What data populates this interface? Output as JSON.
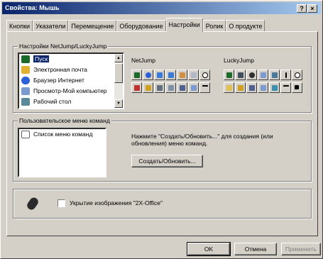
{
  "window": {
    "title": "Свойства: Мышь",
    "help": "?",
    "close": "×"
  },
  "tabs": [
    "Кнопки",
    "Указатели",
    "Перемещение",
    "Оборудование",
    "Настройки",
    "Ролик",
    "О продукте"
  ],
  "active_tab": "Настройки",
  "netjump_group": {
    "legend": "Настройки NetJump/LuckyJump",
    "items": [
      "Пуск",
      "Электронная почта",
      "Браузер Интернет",
      "Просмотр-Мой компьютер",
      "Рабочий стол"
    ],
    "selected": "Пуск",
    "netjump_label": "NetJump",
    "luckyjump_label": "LuckyJump"
  },
  "menu_group": {
    "legend": "Пользовательское меню команд",
    "list_item": "Список меню команд",
    "hint": "Нажмите \"Создать/Обновить...\" для создания (или обновления) меню команд.",
    "create_button": "Создать/Обновить..."
  },
  "bottom": {
    "checkbox_label": "Укрытие изображения \"2X-Office\"",
    "checked": false
  },
  "buttons": {
    "ok": "OK",
    "cancel": "Отмена",
    "apply": "Применить"
  }
}
